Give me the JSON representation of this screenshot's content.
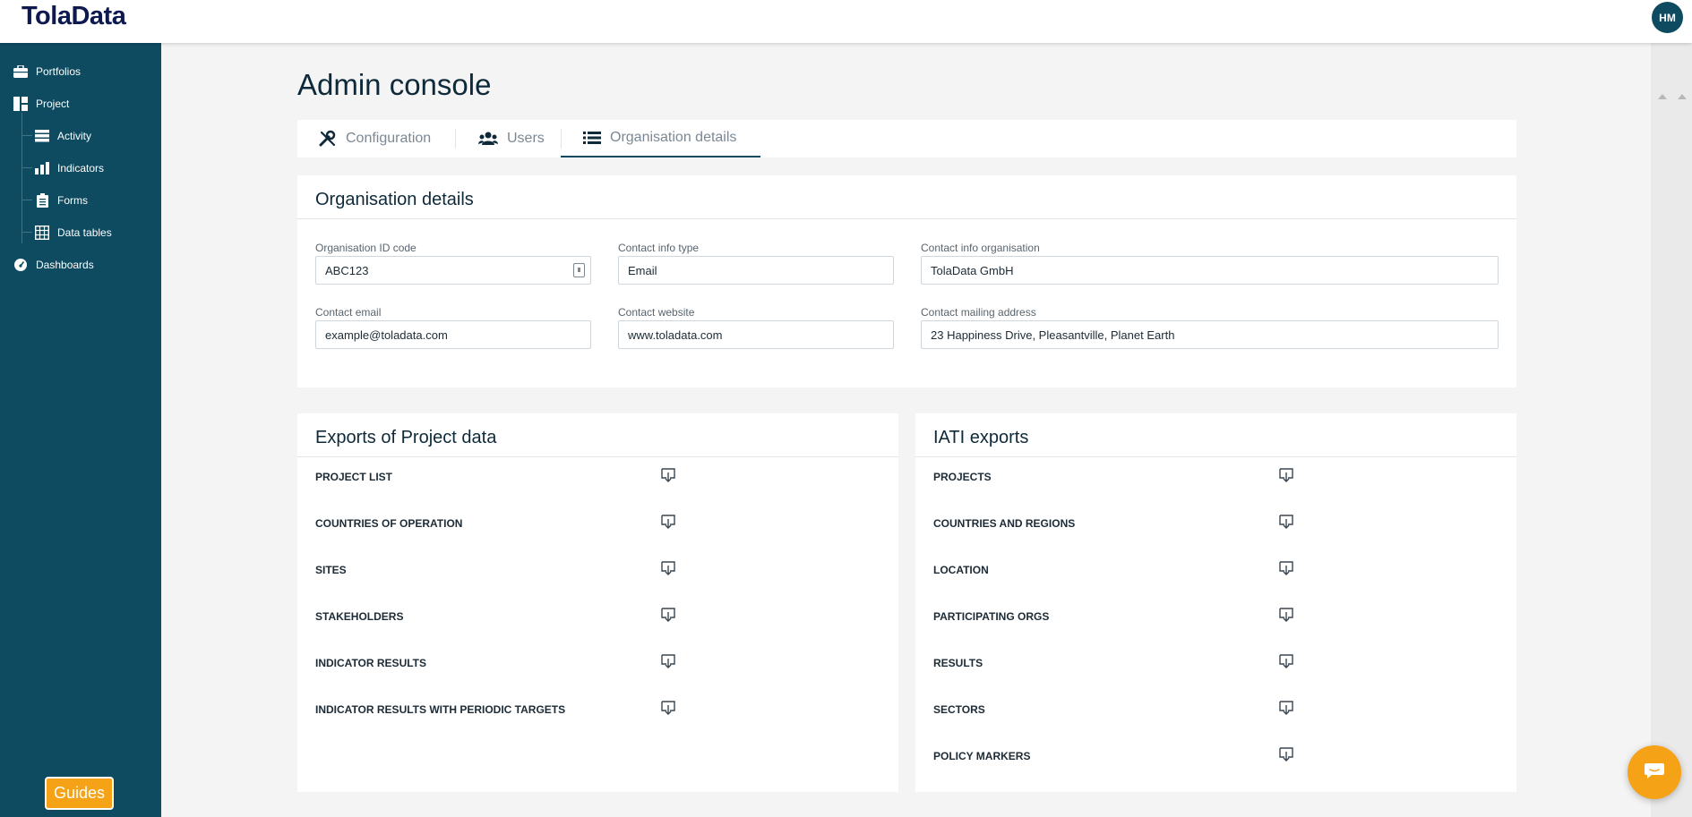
{
  "app": {
    "logo": "TolaData",
    "user_initials": "HM"
  },
  "sidebar": {
    "items": [
      {
        "label": "Portfolios",
        "icon": "briefcase-icon"
      },
      {
        "label": "Project",
        "icon": "project-icon"
      },
      {
        "label": "Activity",
        "icon": "activity-icon"
      },
      {
        "label": "Indicators",
        "icon": "bar-chart-icon"
      },
      {
        "label": "Forms",
        "icon": "clipboard-icon"
      },
      {
        "label": "Data tables",
        "icon": "table-icon"
      },
      {
        "label": "Dashboards",
        "icon": "gauge-icon"
      }
    ],
    "guides_label": "Guides"
  },
  "page": {
    "title": "Admin console"
  },
  "tabs": [
    {
      "label": "Configuration",
      "icon": "wrench-icon"
    },
    {
      "label": "Users",
      "icon": "users-icon"
    },
    {
      "label": "Organisation details",
      "icon": "list-icon",
      "active": true
    }
  ],
  "org_details": {
    "title": "Organisation details",
    "fields": {
      "org_id": {
        "label": "Organisation ID code",
        "value": "ABC123"
      },
      "contact_type": {
        "label": "Contact info type",
        "value": "Email"
      },
      "contact_org": {
        "label": "Contact info organisation",
        "value": "TolaData GmbH"
      },
      "contact_email": {
        "label": "Contact email",
        "value": "example@toladata.com"
      },
      "contact_website": {
        "label": "Contact website",
        "value": "www.toladata.com"
      },
      "contact_address": {
        "label": "Contact mailing address",
        "value": "23 Happiness Drive, Pleasantville, Planet Earth"
      }
    }
  },
  "project_exports": {
    "title": "Exports of Project data",
    "items": [
      "PROJECT LIST",
      "COUNTRIES OF OPERATION",
      "SITES",
      "STAKEHOLDERS",
      "INDICATOR RESULTS",
      "INDICATOR RESULTS WITH PERIODIC TARGETS"
    ]
  },
  "iati_exports": {
    "title": "IATI exports",
    "items": [
      "PROJECTS",
      "COUNTRIES AND REGIONS",
      "LOCATION",
      "PARTICIPATING ORGS",
      "RESULTS",
      "SECTORS",
      "POLICY MARKERS"
    ]
  },
  "colors": {
    "sidebar": "#0e4a60",
    "accent": "#f5a216",
    "logo": "#0e1a4f"
  }
}
